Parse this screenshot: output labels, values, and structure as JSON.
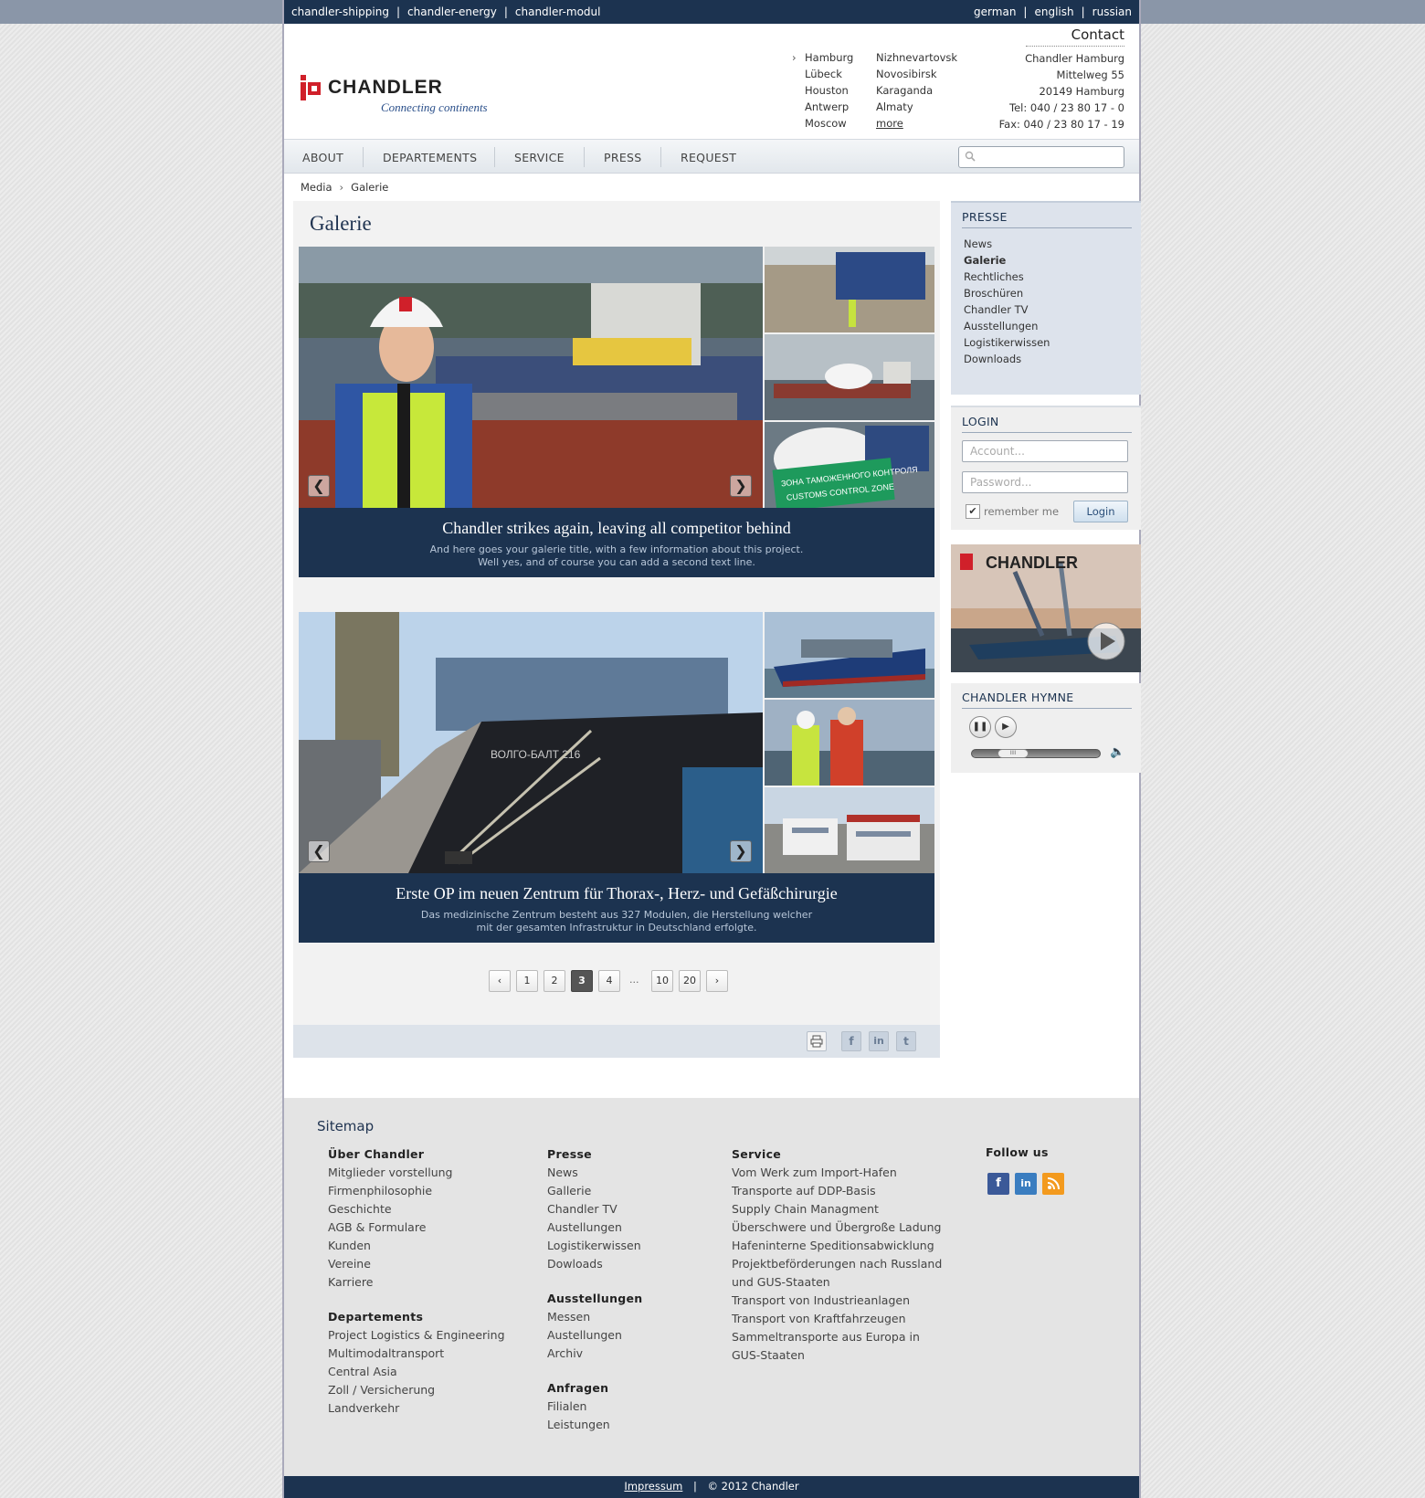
{
  "topbar": {
    "left": [
      "chandler-shipping",
      "chandler-energy",
      "chandler-modul"
    ],
    "right": [
      "german",
      "english",
      "russian"
    ]
  },
  "logo": {
    "word": "CHANDLER",
    "tagline": "Connecting continents"
  },
  "cities": {
    "col1": [
      "Hamburg",
      "Lübeck",
      "Houston",
      "Antwerp",
      "Moscow"
    ],
    "col2": [
      "Nizhnevartovsk",
      "Novosibirsk",
      "Karaganda",
      "Almaty",
      "more"
    ]
  },
  "contact": {
    "title": "Contact",
    "lines": [
      "Chandler Hamburg",
      "Mittelweg 55",
      "20149 Hamburg",
      "Tel: 040 / 23 80 17 - 0",
      "Fax: 040 / 23 80 17 - 19"
    ]
  },
  "nav": [
    "ABOUT",
    "DEPARTEMENTS",
    "SERVICE",
    "PRESS",
    "REQUEST"
  ],
  "breadcrumb": [
    "Media",
    "Galerie"
  ],
  "main": {
    "title": "Galerie"
  },
  "galleries": [
    {
      "title": "Chandler strikes again, leaving all competitor behind",
      "desc1": "And here goes your galerie title, with a few information about this project.",
      "desc2": "Well yes, and of course you can add a second text line."
    },
    {
      "title": "Erste OP im neuen Zentrum für Thorax-, Herz- und Gefäßchirurgie",
      "desc1": "Das medizinische Zentrum besteht aus 327 Modulen, die Herstellung welcher",
      "desc2": "mit der gesamten Infrastruktur in Deutschland erfolgte."
    }
  ],
  "pager": {
    "prev": "‹",
    "next": "›",
    "pages": [
      "1",
      "2",
      "3",
      "4",
      "10",
      "20"
    ],
    "current": "3",
    "ellipsis": "..."
  },
  "sidebar": {
    "presse_title": "PRESSE",
    "presse_items": [
      "News",
      "Galerie",
      "Rechtliches",
      "Broschüren",
      "Chandler TV",
      "Ausstellungen",
      "Logistikerwissen",
      "Downloads"
    ],
    "presse_active": "Galerie",
    "login_title": "LOGIN",
    "account_placeholder": "Account...",
    "password_placeholder": "Password...",
    "remember": "remember me",
    "login_btn": "Login",
    "video_logo": "CHANDLER",
    "hymne_title": "CHANDLER HYMNE"
  },
  "footer": {
    "sitemap": "Sitemap",
    "col1": {
      "h1": "Über Chandler",
      "items1": [
        "Mitglieder vorstellung",
        "Firmenphilosophie",
        "Geschichte",
        "AGB & Formulare",
        "Kunden",
        "Vereine",
        "Karriere"
      ],
      "h2": "Departements",
      "items2": [
        "Project Logistics & Engineering",
        "Multimodaltransport",
        "Central Asia",
        "Zoll / Versicherung",
        "Landverkehr"
      ]
    },
    "col2": {
      "h1": "Presse",
      "items1": [
        "News",
        "Gallerie",
        "Chandler TV",
        "Austellungen",
        "Logistikerwissen",
        "Dowloads"
      ],
      "h2": "Ausstellungen",
      "items2": [
        "Messen",
        "Austellungen",
        "Archiv"
      ],
      "h3": "Anfragen",
      "items3": [
        "Filialen",
        "Leistungen"
      ]
    },
    "col3": {
      "h1": "Service",
      "items": [
        "Vom Werk zum Import-Hafen",
        "Transporte auf DDP-Basis",
        "Supply Chain Managment",
        "Überschwere und Übergroße Ladung",
        "Hafeninterne Speditionsabwicklung",
        "Projektbeförderungen nach Russland",
        "und GUS-Staaten",
        "Transport von Industrieanlagen",
        "Transport von Kraftfahrzeugen",
        "Sammeltransporte aus Europa in",
        "GUS-Staaten"
      ]
    },
    "col4": {
      "h1": "Follow us"
    },
    "impressum": "Impressum",
    "copyright": "© 2012 Chandler"
  },
  "colors": {
    "navy": "#1c3350",
    "logo_red": "#d0202a",
    "facebook": "#3b5998",
    "linkedin": "#3a7dc0",
    "rss": "#f39a1e"
  }
}
